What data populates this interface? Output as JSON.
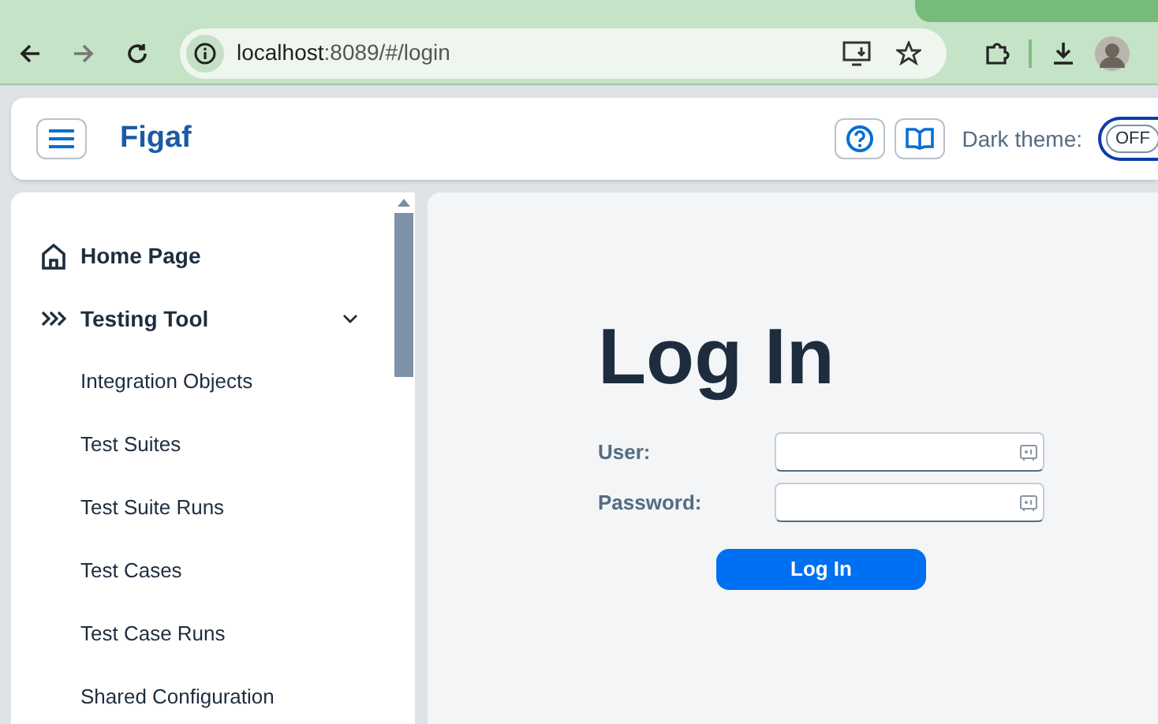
{
  "browser": {
    "url_host": "localhost",
    "url_path": ":8089/#/login"
  },
  "header": {
    "logo": "Figaf",
    "dark_theme_label": "Dark theme:",
    "dark_theme": {
      "on": false,
      "label": "OFF"
    }
  },
  "sidebar": {
    "items": [
      {
        "kind": "home",
        "label": "Home Page"
      },
      {
        "kind": "group",
        "label": "Testing Tool",
        "expanded": true,
        "children": [
          {
            "label": "Integration Objects"
          },
          {
            "label": "Test Suites"
          },
          {
            "label": "Test Suite Runs"
          },
          {
            "label": "Test Cases"
          },
          {
            "label": "Test Case Runs"
          },
          {
            "label": "Shared Configuration"
          }
        ]
      }
    ]
  },
  "login": {
    "title": "Log In",
    "fields": [
      {
        "label": "User:"
      },
      {
        "label": "Password:"
      }
    ],
    "button": "Log In"
  }
}
